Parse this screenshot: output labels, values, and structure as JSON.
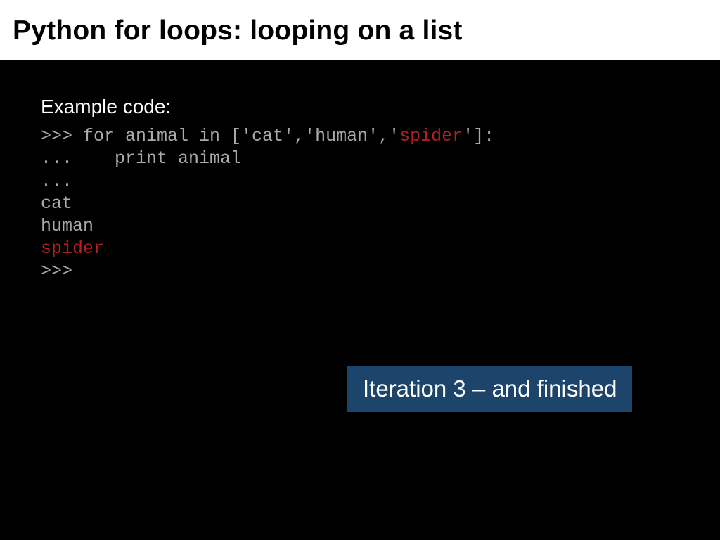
{
  "title": "Python for loops: looping on a list",
  "example_label": "Example code:",
  "code": {
    "line1_a": ">>> for animal in ['cat','human','",
    "line1_hl": "spider",
    "line1_b": "']:",
    "line2": "...    print animal",
    "line3": "...",
    "line4": "cat",
    "line5": "human",
    "line6_hl": "spider",
    "line7": ">>>"
  },
  "callout": "Iteration 3 – and finished"
}
